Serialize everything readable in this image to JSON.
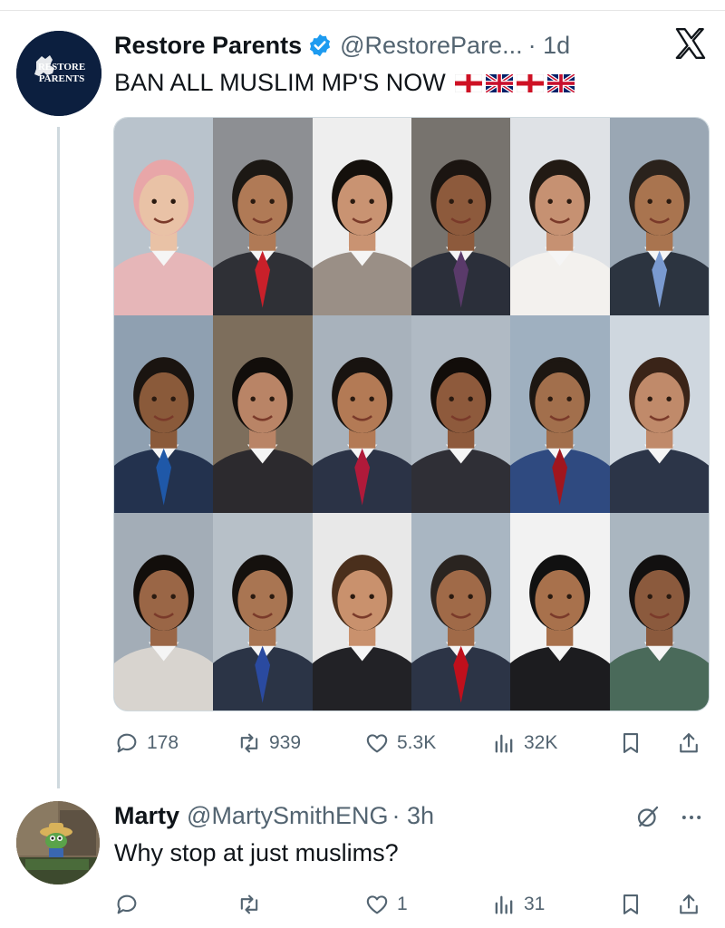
{
  "tweet": {
    "display_name": "Restore Parents",
    "handle": "@RestorePare...",
    "time": "· 1d",
    "text": "BAN ALL MUSLIM MP'S NOW",
    "flags": [
      "england-flag",
      "uk-flag",
      "england-flag",
      "uk-flag"
    ],
    "avatar_text": [
      "RESTORE",
      "PARENTS"
    ],
    "media_grid": {
      "rows": 3,
      "columns": 6,
      "count": 18
    },
    "stats": {
      "replies": "178",
      "reposts": "939",
      "likes": "5.3K",
      "views": "32K"
    }
  },
  "reply": {
    "display_name": "Marty",
    "handle": "@MartySmithENG",
    "time": "· 3h",
    "text": "Why stop at just muslims?",
    "stats": {
      "replies": "",
      "reposts": "",
      "likes": "1",
      "views": "31"
    }
  },
  "colors": {
    "text": "#0f1419",
    "muted": "#536471",
    "verified": "#1d9bf0",
    "avatar_bg": "#0c1f3f",
    "england_red": "#ce1124",
    "uk_blue": "#012169"
  },
  "icons": [
    "x-logo-icon",
    "verified-badge-icon",
    "reply-icon",
    "repost-icon",
    "like-icon",
    "views-icon",
    "bookmark-icon",
    "share-icon",
    "grok-icon",
    "more-icon"
  ]
}
